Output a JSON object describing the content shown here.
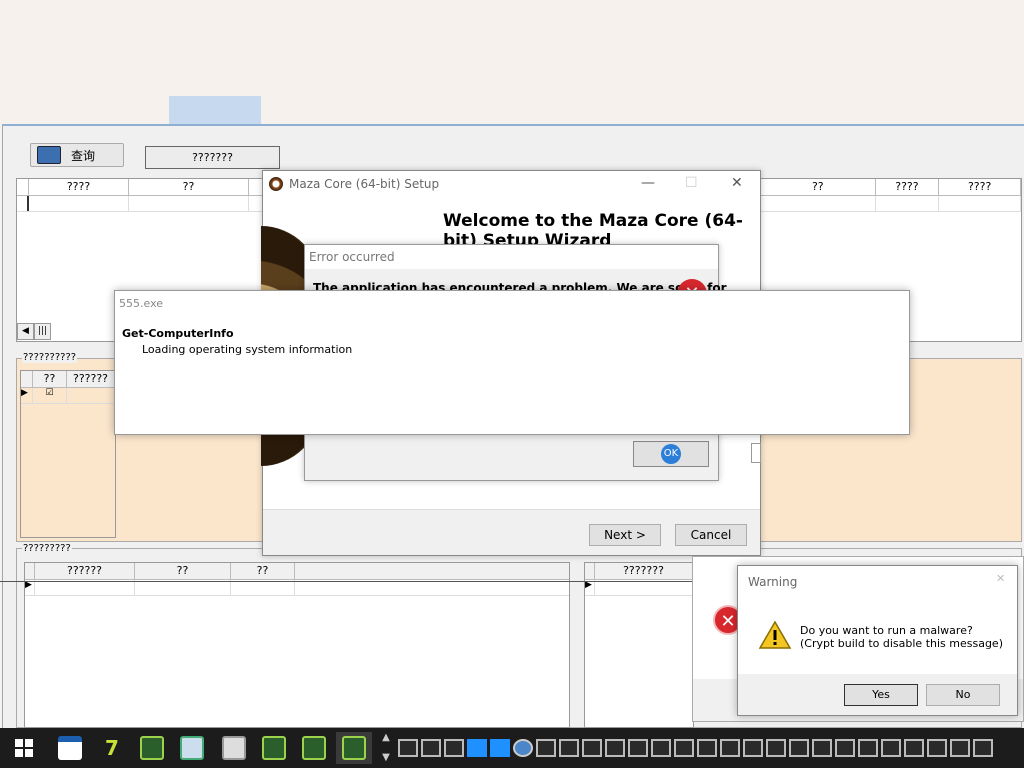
{
  "app": {
    "query_label": "查询",
    "qmark_button": "???????",
    "grid1_headers": [
      "????",
      "??"
    ],
    "grid1_right_headers": [
      "??",
      "????",
      "????"
    ],
    "group2_label": "??????????",
    "grid2_headers": [
      "??",
      "??????"
    ],
    "group3_label": "?????????",
    "grid3_headers": [
      "??????",
      "??",
      "??"
    ],
    "grid4_headers": [
      "???????"
    ],
    "behind_label": "???????????"
  },
  "wizard": {
    "title": "Maza Core (64-bit) Setup",
    "heading": "Welcome to the Maza Core (64-bit) Setup Wizard",
    "next_label": "Next >",
    "cancel_label": "Cancel"
  },
  "error_dialog": {
    "title": "Error occurred",
    "message": "The application has encountered a problem. We are sorry for",
    "ok_label": "OK"
  },
  "process_dialog": {
    "title": "555.exe",
    "heading": "Get-ComputerInfo",
    "status": "Loading operating system information"
  },
  "warning_dialog": {
    "title": "Warning",
    "line1": "Do you want to run a malware?",
    "line2": "(Crypt build to disable this message)",
    "yes_label": "Yes",
    "no_label": "No"
  },
  "taskbar": {
    "apps": [
      "window-app-icon",
      "seven-zip-icon",
      "app-icon",
      "spreadsheet-icon",
      "clock-icon",
      "app-icon",
      "app-icon",
      "app-icon"
    ],
    "tray_count": 27
  },
  "colors": {
    "peach": "#fbe6cc",
    "error_red": "#d9272e",
    "taskbar": "#1c1c1c",
    "titlebar_blue": "#c7d9ee"
  }
}
